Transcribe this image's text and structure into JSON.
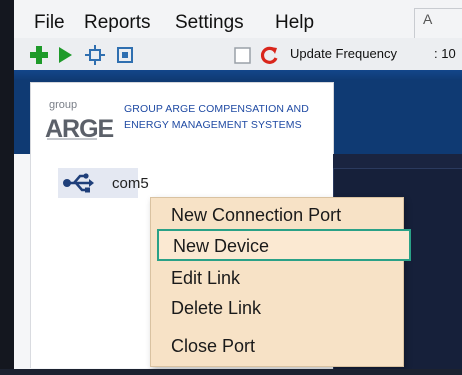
{
  "menubar": {
    "items": [
      "File",
      "Reports",
      "Settings",
      "Help"
    ],
    "right_tab_label": "A"
  },
  "toolbar": {
    "update_frequency_label": "Update Frequency",
    "update_frequency_value": ": 10",
    "icons": [
      "add-icon",
      "play-icon",
      "connect-icon",
      "disconnect-icon",
      "checkbox-icon",
      "refresh-icon"
    ]
  },
  "logo": {
    "mark_top": "group",
    "mark_main": "ARGE",
    "text_line1": "GROUP ARGE COMPENSATION AND",
    "text_line2": "ENERGY MANAGEMENT SYSTEMS"
  },
  "tree": {
    "node_label": "com5",
    "node_icon": "usb-icon"
  },
  "context_menu": {
    "items": [
      "New Connection Port",
      "New Device",
      "Edit Link",
      "Delete Link",
      "Close Port"
    ],
    "highlighted_index": 1
  },
  "colors": {
    "header": "#0f3a73",
    "menu_bg": "#f7e2c6",
    "highlight_border": "#2aa187",
    "logo_text": "#1f4aa3"
  }
}
